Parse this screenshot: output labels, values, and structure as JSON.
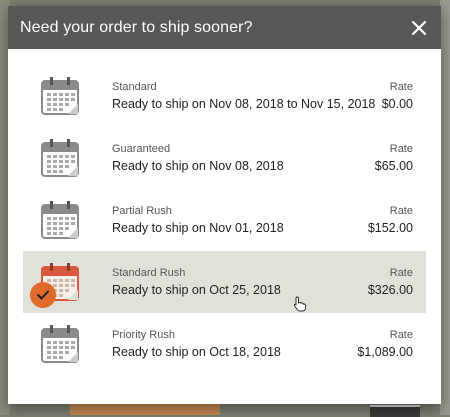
{
  "modal": {
    "title": "Need your order to ship sooner?",
    "close_icon": "close-icon",
    "rate_label": "Rate",
    "options": [
      {
        "name": "Standard",
        "description": "Ready to ship on Nov 08, 2018 to Nov 15, 2018",
        "rate_label": "Rate",
        "rate": "$0.00",
        "selected": false
      },
      {
        "name": "Guaranteed",
        "description": "Ready to ship on Nov 08, 2018",
        "rate_label": "Rate",
        "rate": "$65.00",
        "selected": false
      },
      {
        "name": "Partial Rush",
        "description": "Ready to ship on Nov 01, 2018",
        "rate_label": "Rate",
        "rate": "$152.00",
        "selected": false
      },
      {
        "name": "Standard Rush",
        "description": "Ready to ship on Oct 25, 2018",
        "rate_label": "Rate",
        "rate": "$326.00",
        "selected": true
      },
      {
        "name": "Priority Rush",
        "description": "Ready to ship on Oct 18, 2018",
        "rate_label": "Rate",
        "rate": "$1,089.00",
        "selected": false
      }
    ]
  },
  "colors": {
    "header_bg": "#58585a",
    "selected_bg": "#e1e1da",
    "accent": "#e06a2b",
    "calendar_gray": "#8a8a8a",
    "calendar_selected": "#d9573f"
  }
}
